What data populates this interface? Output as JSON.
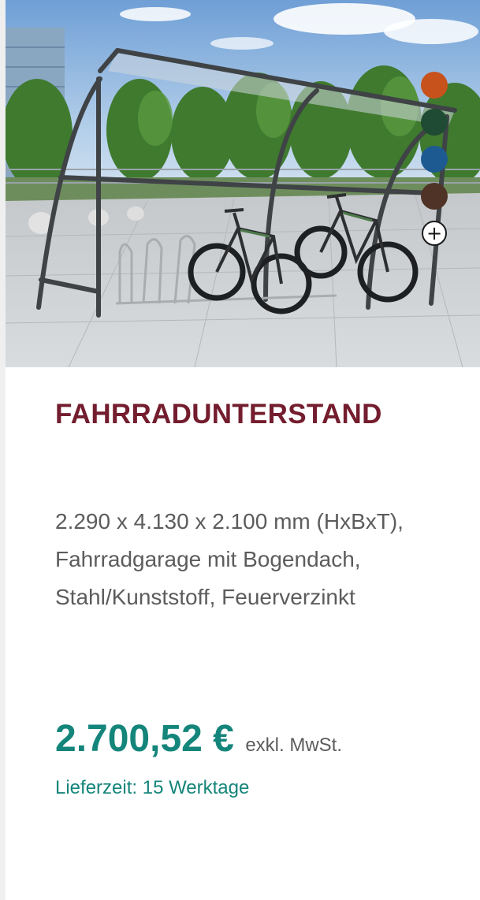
{
  "product": {
    "title": "FAHRRADUNTERSTAND",
    "description_lines": [
      "2.290 x 4.130 x 2.100 mm (HxBxT),",
      "Fahrradgarage mit Bogendach,",
      "Stahl/Kunststoff, Feuerverzinkt"
    ],
    "price": "2.700,52 €",
    "tax_note": "exkl. MwSt.",
    "delivery": "Lieferzeit: 15 Werktage"
  },
  "color_swatches": [
    {
      "name": "orange",
      "color": "#c8521c"
    },
    {
      "name": "dark-green",
      "color": "#1f4a33"
    },
    {
      "name": "blue",
      "color": "#1e5a92"
    },
    {
      "name": "brown",
      "color": "#4f3326"
    }
  ],
  "more_swatches_symbol": "+",
  "colors": {
    "title": "#731d2e",
    "accent": "#14857a",
    "text": "#5c5c5c"
  }
}
